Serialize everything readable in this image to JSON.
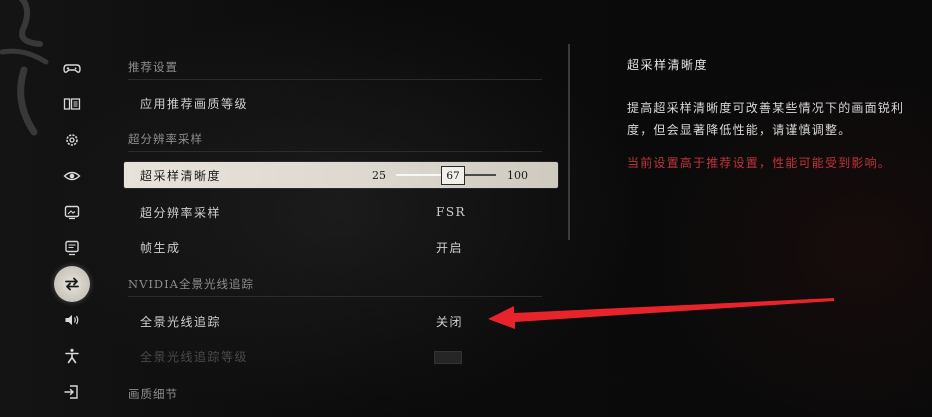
{
  "sidebar": {
    "items": [
      {
        "icon": "gamepad-icon",
        "active": false
      },
      {
        "icon": "display-mode-icon",
        "active": false
      },
      {
        "icon": "gear-icon",
        "active": false
      },
      {
        "icon": "eye-icon",
        "active": false
      },
      {
        "icon": "image-frame-icon",
        "active": false
      },
      {
        "icon": "monitor-icon",
        "active": false
      },
      {
        "icon": "swap-arrows-icon",
        "active": true
      },
      {
        "icon": "speaker-icon",
        "active": false
      },
      {
        "icon": "accessibility-icon",
        "active": false
      },
      {
        "icon": "exit-icon",
        "active": false
      }
    ]
  },
  "settings": {
    "recommended": {
      "heading": "推荐设置",
      "apply_label": "应用推荐画质等级"
    },
    "upscaling": {
      "heading": "超分辨率采样",
      "sharpness": {
        "label": "超采样清晰度",
        "min": "25",
        "max": "100",
        "value": "67"
      },
      "method": {
        "label": "超分辨率采样",
        "value": "FSR"
      },
      "frame_gen": {
        "label": "帧生成",
        "value": "开启"
      }
    },
    "raytracing": {
      "heading": "NVIDIA全景光线追踪",
      "full_rt": {
        "label": "全景光线追踪",
        "value": "关闭"
      },
      "rt_level": {
        "label": "全景光线追踪等级"
      }
    },
    "detail": {
      "heading": "画质细节"
    }
  },
  "description": {
    "title": "超采样清晰度",
    "body": "提高超采样清晰度可改善某些情况下的画面锐利度，但会显著降低性能，请谨慎调整。",
    "warning": "当前设置高于推荐设置，性能可能受到影响。"
  },
  "colors": {
    "warning": "#c0333b",
    "selected_row": "#e7e3db",
    "annotation_arrow": "#e8232b"
  }
}
